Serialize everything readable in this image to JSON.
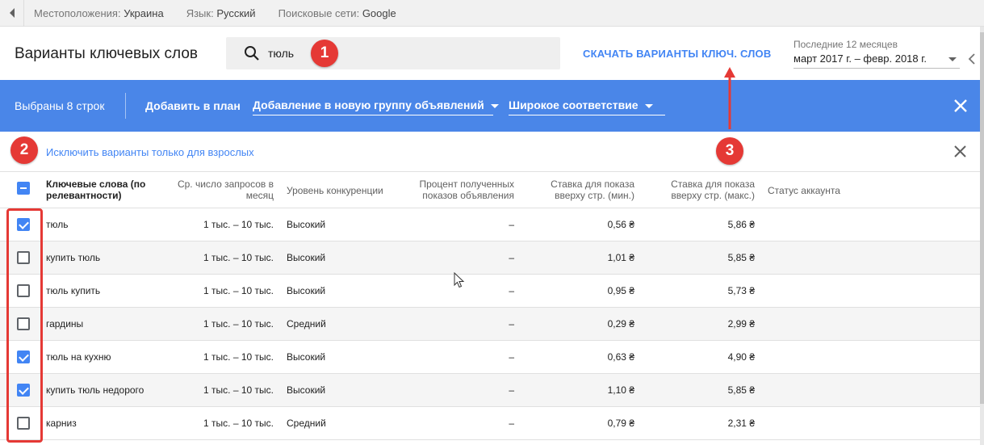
{
  "filters": {
    "location_label": "Местоположения:",
    "location_value": "Украина",
    "language_label": "Язык:",
    "language_value": "Русский",
    "network_label": "Поисковые сети:",
    "network_value": "Google"
  },
  "header": {
    "title": "Варианты ключевых слов",
    "search_value": "тюль",
    "download_label": "СКАЧАТЬ ВАРИАНТЫ КЛЮЧ. СЛОВ",
    "date_label": "Последние 12 месяцев",
    "date_value": "март 2017 г. – февр. 2018 г."
  },
  "action_bar": {
    "selected_count": "Выбраны 8 строк",
    "add_to_plan": "Добавить в план",
    "ad_group_option": "Добавление в новую группу объявлений",
    "match_type_option": "Широкое соответствие"
  },
  "exclude_link": "Исключить варианты только для взрослых",
  "table": {
    "headers": {
      "keyword": [
        "Ключевые слова (по",
        "релевантности)"
      ],
      "searches": [
        "Ср. число запросов в",
        "месяц"
      ],
      "competition": [
        "Уровень конкуренции"
      ],
      "impression_share": [
        "Процент полученных",
        "показов объявления"
      ],
      "bid_low": [
        "Ставка для показа",
        "вверху стр. (мин.)"
      ],
      "bid_high": [
        "Ставка для показа",
        "вверху стр. (макс.)"
      ],
      "status": [
        "Статус аккаунта"
      ]
    },
    "rows": [
      {
        "keyword": "тюль",
        "searches": "1 тыс. – 10 тыс.",
        "competition": "Высокий",
        "share": "–",
        "bid_low": "0,56 ₴",
        "bid_high": "5,86 ₴",
        "checked": true
      },
      {
        "keyword": "купить тюль",
        "searches": "1 тыс. – 10 тыс.",
        "competition": "Высокий",
        "share": "–",
        "bid_low": "1,01 ₴",
        "bid_high": "5,85 ₴",
        "checked": false
      },
      {
        "keyword": "тюль купить",
        "searches": "1 тыс. – 10 тыс.",
        "competition": "Высокий",
        "share": "–",
        "bid_low": "0,95 ₴",
        "bid_high": "5,73 ₴",
        "checked": false
      },
      {
        "keyword": "гардины",
        "searches": "1 тыс. – 10 тыс.",
        "competition": "Средний",
        "share": "–",
        "bid_low": "0,29 ₴",
        "bid_high": "2,99 ₴",
        "checked": false
      },
      {
        "keyword": "тюль на кухню",
        "searches": "1 тыс. – 10 тыс.",
        "competition": "Высокий",
        "share": "–",
        "bid_low": "0,63 ₴",
        "bid_high": "4,90 ₴",
        "checked": true
      },
      {
        "keyword": "купить тюль недорого",
        "searches": "1 тыс. – 10 тыс.",
        "competition": "Высокий",
        "share": "–",
        "bid_low": "1,10 ₴",
        "bid_high": "5,85 ₴",
        "checked": true
      },
      {
        "keyword": "карниз",
        "searches": "1 тыс. – 10 тыс.",
        "competition": "Средний",
        "share": "–",
        "bid_low": "0,79 ₴",
        "bid_high": "2,31 ₴",
        "checked": false
      }
    ]
  },
  "annotations": [
    "1",
    "2",
    "3"
  ],
  "colors": {
    "accent_blue": "#4a86e8",
    "link_blue": "#4285f4",
    "annotation_red": "#e53935"
  },
  "icons": [
    "back-arrow-icon",
    "search-icon",
    "chevron-down-icon",
    "chevron-left-icon",
    "close-icon",
    "checkbox-icon",
    "mouse-cursor-icon"
  ]
}
